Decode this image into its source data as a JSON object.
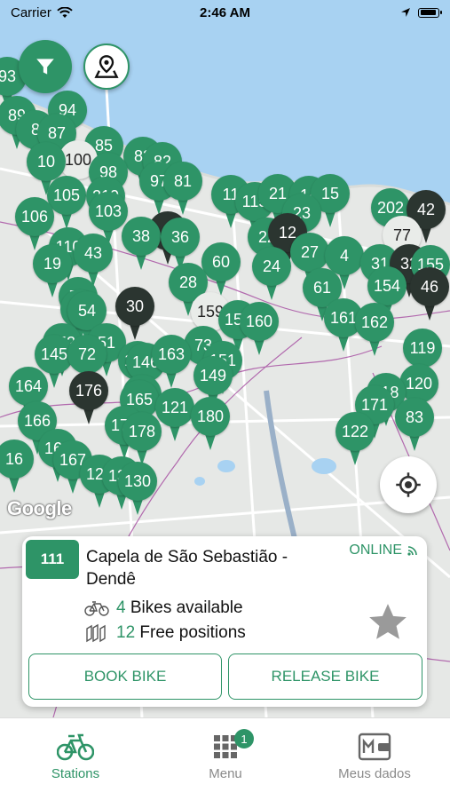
{
  "status_bar": {
    "carrier": "Carrier",
    "time": "2:46 AM"
  },
  "map": {
    "attribution": "Google",
    "stations": [
      {
        "n": "93",
        "s": "g"
      },
      {
        "n": "89",
        "s": "g"
      },
      {
        "n": "94",
        "s": "g"
      },
      {
        "n": "8",
        "s": "g"
      },
      {
        "n": "87",
        "s": "g"
      },
      {
        "n": "85",
        "s": "g"
      },
      {
        "n": "83",
        "s": "g"
      },
      {
        "n": "82",
        "s": "g"
      },
      {
        "n": "100",
        "s": "l"
      },
      {
        "n": "10",
        "s": "g"
      },
      {
        "n": "98",
        "s": "g"
      },
      {
        "n": "97",
        "s": "g"
      },
      {
        "n": "81",
        "s": "g"
      },
      {
        "n": "105",
        "s": "g"
      },
      {
        "n": "210",
        "s": "g"
      },
      {
        "n": "106",
        "s": "g"
      },
      {
        "n": "103",
        "s": "g"
      },
      {
        "n": "1",
        "s": "d"
      },
      {
        "n": "38",
        "s": "g"
      },
      {
        "n": "36",
        "s": "g"
      },
      {
        "n": "11",
        "s": "g"
      },
      {
        "n": "115",
        "s": "g"
      },
      {
        "n": "21",
        "s": "g"
      },
      {
        "n": "14",
        "s": "g"
      },
      {
        "n": "15",
        "s": "g"
      },
      {
        "n": "202",
        "s": "g"
      },
      {
        "n": "42",
        "s": "d"
      },
      {
        "n": "110",
        "s": "g"
      },
      {
        "n": "43",
        "s": "g"
      },
      {
        "n": "19",
        "s": "g"
      },
      {
        "n": "22",
        "s": "g"
      },
      {
        "n": "23",
        "s": "g"
      },
      {
        "n": "12",
        "s": "d"
      },
      {
        "n": "77",
        "s": "l"
      },
      {
        "n": "60",
        "s": "g"
      },
      {
        "n": "24",
        "s": "g"
      },
      {
        "n": "27",
        "s": "g"
      },
      {
        "n": "4",
        "s": "g"
      },
      {
        "n": "31",
        "s": "g"
      },
      {
        "n": "32",
        "s": "d"
      },
      {
        "n": "155",
        "s": "g"
      },
      {
        "n": "28",
        "s": "g"
      },
      {
        "n": "75",
        "s": "g"
      },
      {
        "n": "61",
        "s": "g"
      },
      {
        "n": "154",
        "s": "g"
      },
      {
        "n": "46",
        "s": "d"
      },
      {
        "n": "56",
        "s": "g"
      },
      {
        "n": "54",
        "s": "g"
      },
      {
        "n": "30",
        "s": "d"
      },
      {
        "n": "159",
        "s": "l"
      },
      {
        "n": "153",
        "s": "g"
      },
      {
        "n": "160",
        "s": "g"
      },
      {
        "n": "161",
        "s": "g"
      },
      {
        "n": "162",
        "s": "g"
      },
      {
        "n": "152",
        "s": "g"
      },
      {
        "n": "51",
        "s": "g"
      },
      {
        "n": "145",
        "s": "g"
      },
      {
        "n": "72",
        "s": "g"
      },
      {
        "n": "175",
        "s": "g"
      },
      {
        "n": "146",
        "s": "g"
      },
      {
        "n": "73",
        "s": "g"
      },
      {
        "n": "163",
        "s": "g"
      },
      {
        "n": "151",
        "s": "g"
      },
      {
        "n": "119",
        "s": "g"
      },
      {
        "n": "164",
        "s": "g"
      },
      {
        "n": "149",
        "s": "g"
      },
      {
        "n": "120",
        "s": "g"
      },
      {
        "n": "176",
        "s": "d"
      },
      {
        "n": "148",
        "s": "g"
      },
      {
        "n": "118",
        "s": "g"
      },
      {
        "n": "165",
        "s": "g"
      },
      {
        "n": "121",
        "s": "g"
      },
      {
        "n": "171",
        "s": "g"
      },
      {
        "n": "166",
        "s": "g"
      },
      {
        "n": "180",
        "s": "g"
      },
      {
        "n": "83",
        "s": "g"
      },
      {
        "n": "170",
        "s": "g"
      },
      {
        "n": "122",
        "s": "g"
      },
      {
        "n": "178",
        "s": "g"
      },
      {
        "n": "16",
        "s": "g"
      },
      {
        "n": "169",
        "s": "g"
      },
      {
        "n": "167",
        "s": "g"
      },
      {
        "n": "124",
        "s": "g"
      },
      {
        "n": "132",
        "s": "g"
      },
      {
        "n": "130",
        "s": "g"
      }
    ]
  },
  "station_card": {
    "id": "111",
    "name": "Capela de São Sebastião - Dendê",
    "status": "ONLINE",
    "bikes_count": "4",
    "bikes_label": "Bikes available",
    "free_count": "12",
    "free_label": "Free positions",
    "book_label": "BOOK BIKE",
    "release_label": "RELEASE BIKE"
  },
  "tabbar": {
    "stations_label": "Stations",
    "menu_label": "Menu",
    "menu_badge": "1",
    "profile_label": "Meus dados"
  },
  "colors": {
    "brand": "#2e9467",
    "dark_pin": "#2b3530"
  }
}
